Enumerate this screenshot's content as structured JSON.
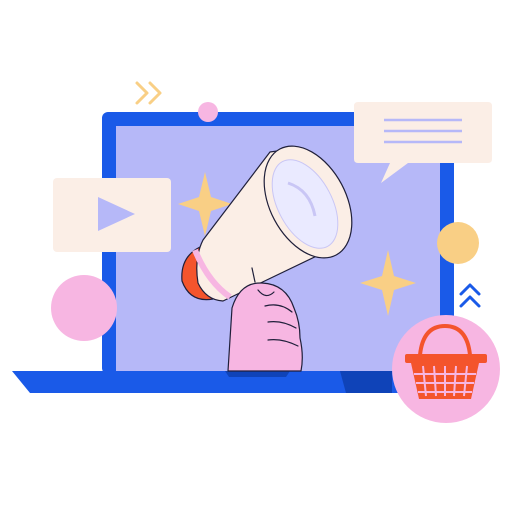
{
  "illustration": {
    "subject": "megaphone-marketing-laptop",
    "colors": {
      "laptop_frame": "#1a5ae8",
      "laptop_base": "#1a5ae8",
      "screen": "#b6b8f8",
      "hand": "#f7b6e2",
      "megaphone_body": "#fbeee6",
      "megaphone_mouth": "#f4542c",
      "star": "#f9cf85",
      "bubble": "#fbeee6",
      "bubble_lines": "#b6b8f8",
      "circle_pink": "#f7b6e2",
      "circle_yellow": "#f9cf85",
      "basket": "#f4542c",
      "chevrons_yellow": "#f9cf85",
      "chevrons_blue": "#1a5ae8",
      "outline": "#1f1f3a"
    },
    "icons": [
      "laptop-icon",
      "megaphone-icon",
      "hand-icon",
      "play-video-icon",
      "chat-bubble-icon",
      "shopping-basket-icon",
      "star-icon",
      "chevrons-right-icon",
      "chevrons-up-icon"
    ]
  }
}
